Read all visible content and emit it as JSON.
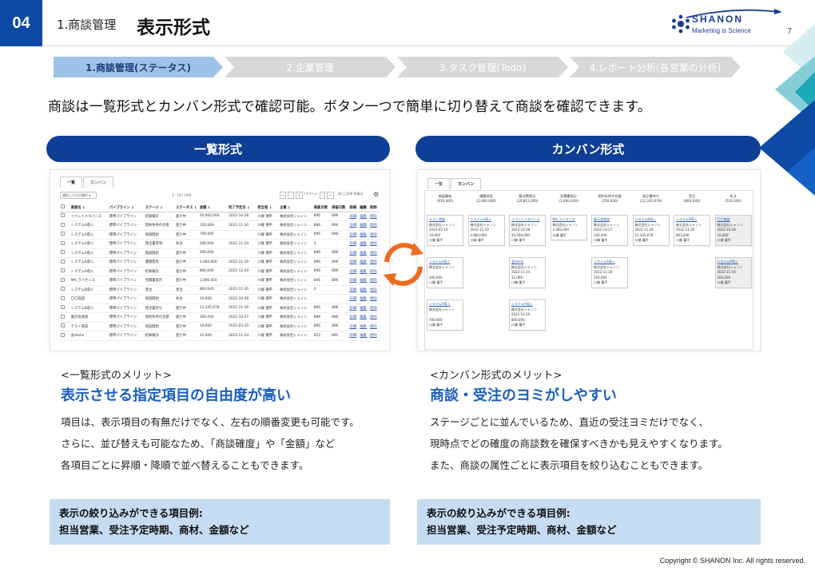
{
  "header": {
    "number": "04",
    "section": "1.商談管理",
    "title": "表示形式",
    "page_number": "7",
    "logo": {
      "name": "SHANON",
      "tagline": "Marketing is Science"
    }
  },
  "steps": [
    {
      "label": "1.商談管理(ステータス)",
      "active": true
    },
    {
      "label": "2.企業管理",
      "active": false
    },
    {
      "label": "3.タスク管理(Todo)",
      "active": false
    },
    {
      "label": "4.レポート分析(各営業の分析)",
      "active": false
    }
  ],
  "lead": "商談は一覧形式とカンバン形式で確認可能。ボタン一つで簡単に切り替えて商談を確認できます。",
  "list_view": {
    "pill": "一覧形式",
    "tabs": [
      "一覧",
      "カンバン"
    ],
    "select_label": "選択した行の操作 ▾",
    "count_text": "1 - 14 / 14件",
    "pager": [
      "«",
      "‹",
      "1",
      "/ 1ページ",
      "›",
      "»"
    ],
    "radio_text": "30 ◯100 件表示",
    "columns": [
      "",
      "商談名 ↓",
      "パイプライン ↓",
      "ステージ ↓",
      "ステータス ↓",
      "金額 ↓",
      "完了予定日 ↓",
      "担当者 ↓",
      "企業 ↓",
      "商談日数",
      "滞留日数",
      "詳細",
      "編集",
      "削除"
    ],
    "rows": [
      [
        "イベントメタバース",
        "標準パイプライン",
        "結果検討",
        "進行中",
        "20,000,000",
        "2022-10-28",
        "川端 蓮平",
        "株式会社シャノン",
        "896",
        "896",
        "詳細",
        "編集",
        "削除"
      ],
      [
        "システムA導入",
        "標準パイプライン",
        "契約条件の合意",
        "進行中",
        "150,000",
        "2022-11-30",
        "川端 蓮平",
        "株式会社シャノン",
        "896",
        "896",
        "詳細",
        "編集",
        "削除"
      ],
      [
        "システムA導入",
        "標準パイプライン",
        "商談開始",
        "進行中",
        "700,000",
        "",
        "川端 蓮平",
        "株式会社シャノン",
        "896",
        "896",
        "詳細",
        "編集",
        "削除"
      ],
      [
        "システムA導入",
        "標準パイプライン",
        "発注書受領",
        "失注",
        "500,000",
        "2022-11-24",
        "川端 蓮平",
        "株式会社シャノン",
        "0",
        "",
        "詳細",
        "編集",
        "削除"
      ],
      [
        "システムA導入",
        "標準パイプライン",
        "商談開始",
        "進行中",
        "200,000",
        "",
        "川端 蓮平",
        "株式会社シャノン",
        "896",
        "896",
        "詳細",
        "編集",
        "削除"
      ],
      [
        "システムA導入",
        "標準パイプライン",
        "課題発見",
        "進行中",
        "2,000,000",
        "2022-11-30",
        "川端 蓮平",
        "株式会社シャノン",
        "896",
        "896",
        "詳細",
        "編集",
        "削除"
      ],
      [
        "システムA導入",
        "標準パイプライン",
        "結果検討",
        "進行中",
        "800,000",
        "2022-12-29",
        "川端 蓮平",
        "株式会社シャノン",
        "896",
        "896",
        "詳細",
        "編集",
        "削除"
      ],
      [
        "MA_ライセンス",
        "標準パイプライン",
        "見積書提示",
        "進行中",
        "1,000,000",
        "",
        "川端 蓮平",
        "株式会社シャノン",
        "896",
        "896",
        "詳細",
        "編集",
        "削除"
      ],
      [
        "システムB導入",
        "標準パイプライン",
        "受注",
        "受注",
        "893,040",
        "2022-11-30",
        "川端 蓮平",
        "株式会社シャノン",
        "0",
        "",
        "詳細",
        "編集",
        "削除"
      ],
      [
        "〇〇商談",
        "標準パイプライン",
        "商談開始",
        "失注",
        "10,000",
        "2022-10-28",
        "川端 蓮平",
        "株式会社シャノン",
        "",
        "",
        "詳細",
        "編集",
        "削除"
      ],
      [
        "システムB導入",
        "標準パイプライン",
        "発注書待ち",
        "進行中",
        "12,345,678",
        "2022-11-30",
        "川端 蓮平",
        "株式会社シャノン",
        "896",
        "896",
        "詳細",
        "編集",
        "削除"
      ],
      [
        "展示会商談",
        "標準パイプライン",
        "契約条件の合意",
        "進行中",
        "100,000",
        "2022-10-27",
        "川端 蓮平",
        "株式会社シャノン",
        "896",
        "896",
        "詳細",
        "編集",
        "削除"
      ],
      [
        "テスト商談",
        "標準パイプライン",
        "商談開始",
        "進行中",
        "10,000",
        "2023-03-10",
        "川端 蓮平",
        "株式会社シャノン",
        "896",
        "896",
        "詳細",
        "編集",
        "削除"
      ],
      [
        "会demo",
        "標準パイプライン",
        "結果検討",
        "進行中",
        "12,000",
        "2022-11-24",
        "川端 蓮平",
        "株式会社シャノン",
        "922",
        "895",
        "詳細",
        "編集",
        "削除"
      ]
    ]
  },
  "kanban_view": {
    "pill": "カンバン形式",
    "tabs": [
      "一覧",
      "カンバン"
    ],
    "columns": [
      {
        "name": "商談開始",
        "total": "(910,000)"
      },
      {
        "name": "課題発見",
        "total": "(2,000,000)"
      },
      {
        "name": "解決策提示",
        "total": "(20,812,000)"
      },
      {
        "name": "見積書提示",
        "total": "(1,000,000)"
      },
      {
        "name": "契約条件の合意",
        "total": "(250,000)"
      },
      {
        "name": "発注書待ち",
        "total": "(12,345,678)"
      },
      {
        "name": "受注",
        "total": "(893,040)"
      },
      {
        "name": "失注",
        "total": "(510,000)"
      }
    ],
    "cards": [
      {
        "col": 0,
        "row": 0,
        "title": "テスト商談",
        "lines": [
          "株式会社シャノン",
          "2023-03-10",
          "10,000",
          "川端 蓮平"
        ]
      },
      {
        "col": 0,
        "row": 1,
        "title": "システムA導入",
        "lines": [
          "株式会社シャノン",
          "",
          "200,000",
          "川端 蓮平"
        ]
      },
      {
        "col": 0,
        "row": 2,
        "title": "システムA導入",
        "lines": [
          "株式会社シャノン",
          "",
          "700,000",
          "川端 蓮平"
        ]
      },
      {
        "col": 1,
        "row": 0,
        "title": "システムA導入",
        "lines": [
          "株式会社シャノン",
          "2022-11-30",
          "2,000,000",
          "川端 蓮平"
        ]
      },
      {
        "col": 2,
        "row": 0,
        "title": "イベントメタバース",
        "lines": [
          "株式会社シャノン",
          "2022-10-28",
          "20,000,000",
          "川端 蓮平"
        ]
      },
      {
        "col": 2,
        "row": 1,
        "title": "会demo",
        "lines": [
          "株式会社シャノン",
          "2022-11-24",
          "12,000",
          "川端 蓮平"
        ]
      },
      {
        "col": 2,
        "row": 2,
        "title": "システムA導入",
        "lines": [
          "株式会社シャノン",
          "2022-12-29",
          "800,000",
          "川端 蓮平"
        ]
      },
      {
        "col": 3,
        "row": 0,
        "title": "MA_ライセンス",
        "lines": [
          "株式会社シャノン",
          "1,000,000",
          "川端 蓮平"
        ]
      },
      {
        "col": 4,
        "row": 0,
        "title": "展示会商談",
        "lines": [
          "株式会社シャノン",
          "2022-10-27",
          "100,000",
          "川端 蓮平"
        ]
      },
      {
        "col": 4,
        "row": 1,
        "title": "システムA導入",
        "lines": [
          "株式会社シャノン",
          "2022-11-30",
          "150,000",
          "川端 蓮平"
        ]
      },
      {
        "col": 5,
        "row": 0,
        "title": "システムB導入",
        "lines": [
          "株式会社シャノン",
          "2022-11-30",
          "12,345,678",
          "川端 蓮平"
        ]
      },
      {
        "col": 6,
        "row": 0,
        "title": "システムB導入",
        "lines": [
          "株式会社シャノン",
          "2022-11-30",
          "893,040",
          "川端 蓮平"
        ]
      },
      {
        "col": 7,
        "row": 0,
        "title": "〇〇商談",
        "lines": [
          "株式会社シャノン",
          "2022-10-28",
          "10,000",
          "川端 蓮平"
        ],
        "grey": true
      },
      {
        "col": 7,
        "row": 1,
        "title": "システムA導入",
        "lines": [
          "株式会社シャノン",
          "2022-11-24",
          "500,000",
          "川端 蓮平"
        ],
        "grey": true
      }
    ]
  },
  "merits": {
    "left": {
      "head": "<一覧形式のメリット>",
      "title": "表示させる指定項目の自由度が高い",
      "body": [
        "項目は、表示項目の有無だけでなく、左右の順番変更も可能です。",
        "さらに、並び替えも可能なため、「商談確度」や「金額」など",
        "各項目ごとに昇順・降順で並べ替えることもできます。"
      ]
    },
    "right": {
      "head": "<カンバン形式のメリット>",
      "title": "商談・受注のヨミがしやすい",
      "body": [
        "ステージごとに並んでいるため、直近の受注ヨミだけでなく、",
        "現時点でどの確度の商談数を確保すべきかも見えやすくなります。",
        "また、商談の属性ごとに表示項目を絞り込むこともできます。"
      ]
    }
  },
  "filters": {
    "left": {
      "label": "表示の絞り込みができる項目例:",
      "value": "担当営業、受注予定時期、商材、金額など"
    },
    "right": {
      "label": "表示の絞り込みができる項目例:",
      "value": "担当営業、受注予定時期、商材、金額など"
    }
  },
  "copyright": "Copyright © SHANON Inc. All rights reserved.",
  "colors": {
    "primary": "#0d4aa6",
    "pill": "#0d3f96",
    "accent_text": "#1a5fc0",
    "filter_bg": "#c5dcf2",
    "cycle_orange": "#ee6a1f"
  }
}
